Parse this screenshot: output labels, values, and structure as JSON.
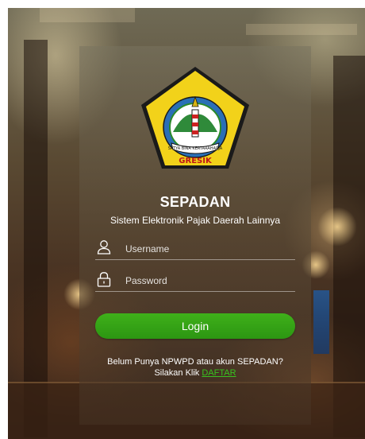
{
  "brand": {
    "logo_ribbon": "SATYA BINA KERTARAHARJA",
    "logo_name": "GRESIK"
  },
  "app": {
    "title": "SEPADAN",
    "subtitle": "Sistem Elektronik Pajak Daerah Lainnya"
  },
  "form": {
    "username_placeholder": "Username",
    "password_placeholder": "Password",
    "login_label": "Login"
  },
  "register": {
    "question": "Belum Punya NPWPD atau akun SEPADAN?",
    "prompt": "Silakan Klik",
    "link_label": "DAFTAR"
  },
  "icons": {
    "username": "user-icon",
    "password": "lock-icon"
  },
  "colors": {
    "accent": "#2f9e14",
    "link": "#38c21f"
  }
}
